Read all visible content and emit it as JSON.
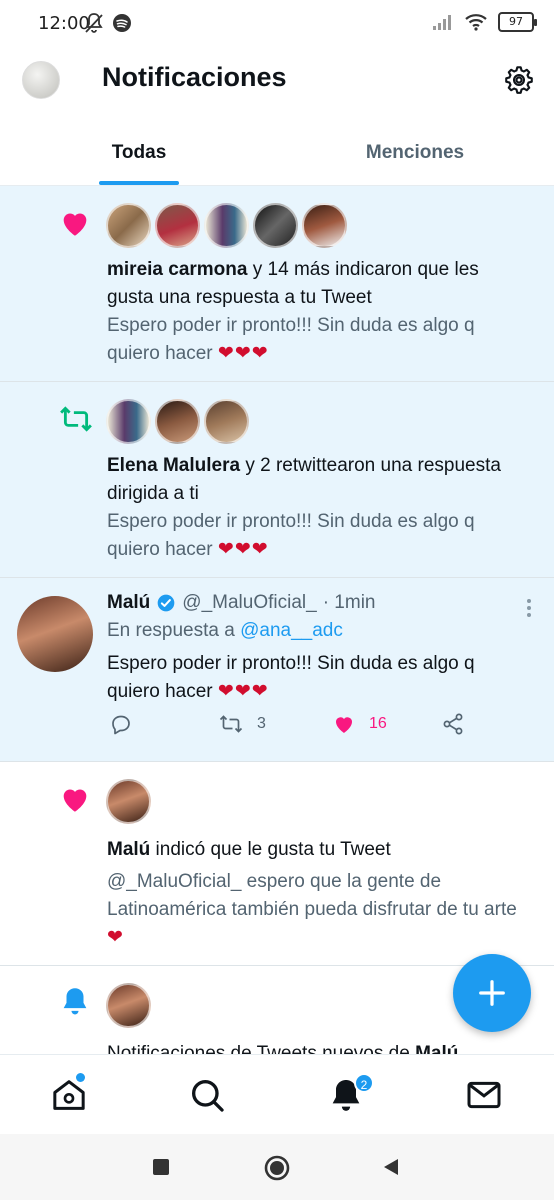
{
  "status_bar": {
    "time": "12:00",
    "battery": "97",
    "icons": [
      "dnd-off-icon",
      "spotify-icon",
      "signal-icon",
      "wifi-icon",
      "battery-icon"
    ]
  },
  "header": {
    "title": "Notificaciones",
    "settings_icon": "gear-icon"
  },
  "tabs": [
    {
      "label": "Todas",
      "selected": true
    },
    {
      "label": "Menciones",
      "selected": false
    }
  ],
  "notifications": [
    {
      "type": "like",
      "icon": "heart-icon",
      "actor": "mireia carmona",
      "action": " y 14 más indicaron que les gusta una respuesta a tu Tweet",
      "preview": "Espero poder ir pronto!!! Sin duda es algo q quiero hacer ",
      "emoji": "❤❤❤"
    },
    {
      "type": "retweet",
      "icon": "retweet-icon",
      "actor": "Elena Malulera",
      "action": " y 2 retwittearon una respuesta dirigida a ti",
      "preview": "Espero poder ir pronto!!! Sin duda es algo q quiero hacer ",
      "emoji": "❤❤❤"
    },
    {
      "type": "tweet",
      "name": "Malú",
      "handle": "@_MaluOficial_",
      "time": "· 1min",
      "reply_prefix": "En respuesta a ",
      "reply_to": "@ana__adc",
      "text": "Espero poder ir pronto!!! Sin duda es algo q quiero hacer ",
      "emoji": "❤❤❤",
      "retweets": "3",
      "likes": "16",
      "liked": true
    },
    {
      "type": "like",
      "icon": "heart-icon",
      "actor": "Malú",
      "action": " indicó que le gusta tu Tweet",
      "preview": "@_MaluOficial_ espero que la gente de Latinoamérica también pueda disfrutar de tu arte ",
      "emoji": "❤"
    },
    {
      "type": "tweet_notification",
      "icon": "bell-icon",
      "text": "Notificaciones de Tweets nuevos de ",
      "actor": "Malú"
    }
  ],
  "fab": {
    "icon": "plus-icon"
  },
  "bottom_nav": [
    {
      "icon": "home-icon",
      "has_dot": true
    },
    {
      "icon": "search-icon"
    },
    {
      "icon": "bell-icon",
      "badge": "2"
    },
    {
      "icon": "mail-icon"
    }
  ],
  "system_nav": [
    "square-icon",
    "circle-icon",
    "back-icon"
  ],
  "colors": {
    "accent": "#1d9bf0",
    "like": "#f91880",
    "retweet": "#00ba7c",
    "unread_bg": "#e8f5fd",
    "muted": "#536471"
  }
}
